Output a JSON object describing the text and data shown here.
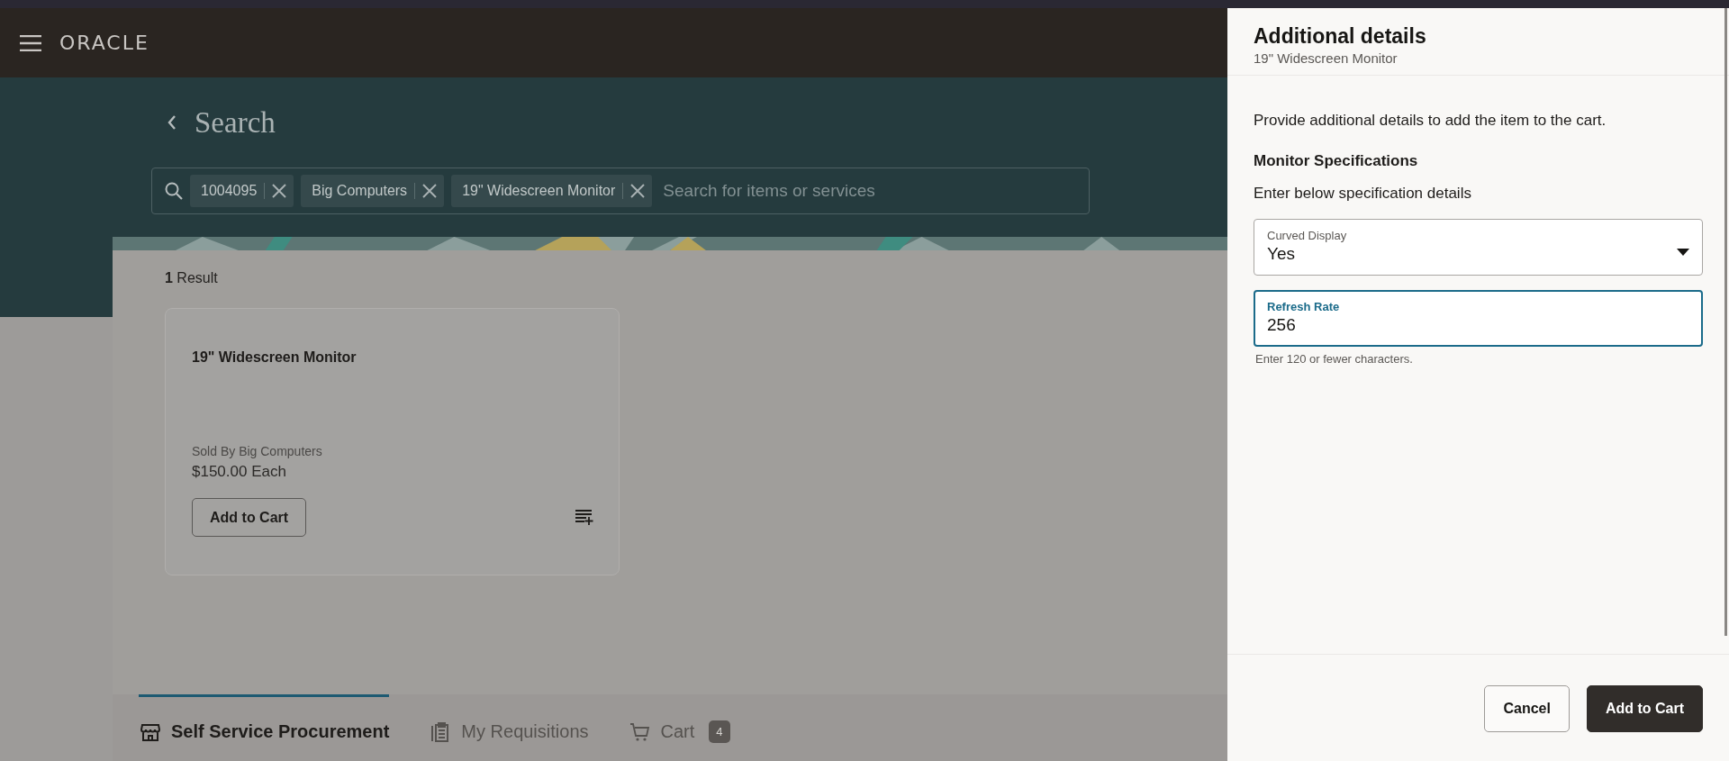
{
  "header": {
    "brand": "ORACLE"
  },
  "page": {
    "title": "Search"
  },
  "search": {
    "chips": [
      {
        "label": "1004095"
      },
      {
        "label": "Big Computers"
      },
      {
        "label": "19\" Widescreen Monitor"
      }
    ],
    "placeholder": "Search for items or services"
  },
  "results": {
    "summary": "**1** Result",
    "items": [
      {
        "title": "19\" Widescreen Monitor",
        "seller": "Sold By Big Computers",
        "price": "$150.00 Each",
        "button": "Add to Cart"
      }
    ]
  },
  "tabs": [
    {
      "label": "Self Service Procurement",
      "kind": "store",
      "selected": true
    },
    {
      "label": "My Requisitions",
      "kind": "clipboard",
      "selected": false
    },
    {
      "label": "Cart",
      "kind": "cart",
      "selected": false,
      "badge": "4"
    }
  ],
  "drawer": {
    "title": "Additional details",
    "subtitle": "19\" Widescreen Monitor",
    "intro": "Provide additional details to add the item to the cart.",
    "section_title": "Monitor Specifications",
    "section_text": "Enter below specification details",
    "fields": [
      {
        "kind": "select",
        "label": "Curved Display",
        "value": "Yes",
        "focused": false
      },
      {
        "kind": "text",
        "label": "Refresh Rate",
        "value": "256",
        "focused": true,
        "helper": "Enter 120 or fewer characters."
      }
    ],
    "buttons": [
      {
        "label": "Cancel",
        "kind": "secondary"
      },
      {
        "label": "Add to Cart",
        "kind": "primary"
      }
    ]
  }
}
